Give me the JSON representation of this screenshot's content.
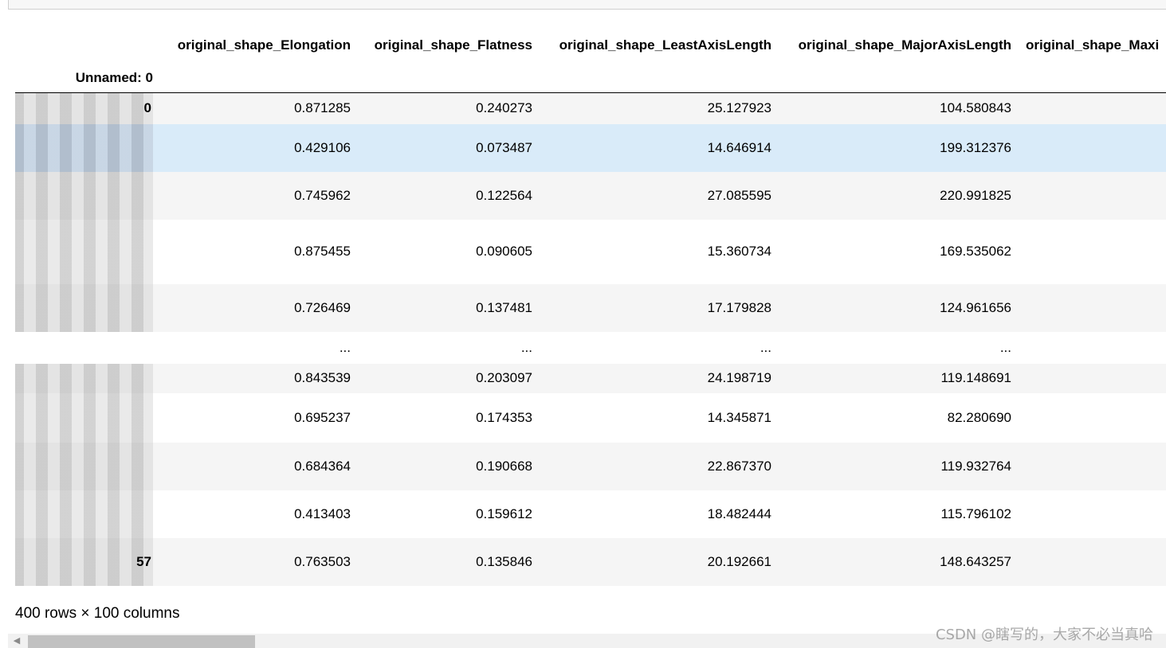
{
  "table": {
    "columns": [
      "original_shape_Elongation",
      "original_shape_Flatness",
      "original_shape_LeastAxisLength",
      "original_shape_MajorAxisLength",
      "original_shape_Maxi"
    ],
    "index_header": "Unnamed: 0",
    "rows": [
      {
        "index": "0",
        "elong": "0.871285",
        "flat": "0.240273",
        "least": "25.127923",
        "major": "104.580843"
      },
      {
        "index": "",
        "elong": "0.429106",
        "flat": "0.073487",
        "least": "14.646914",
        "major": "199.312376"
      },
      {
        "index": "",
        "elong": "0.745962",
        "flat": "0.122564",
        "least": "27.085595",
        "major": "220.991825"
      },
      {
        "index": "",
        "elong": "0.875455",
        "flat": "0.090605",
        "least": "15.360734",
        "major": "169.535062"
      },
      {
        "index": "",
        "elong": "0.726469",
        "flat": "0.137481",
        "least": "17.179828",
        "major": "124.961656"
      },
      {
        "index": "",
        "elong": "...",
        "flat": "...",
        "least": "...",
        "major": "..."
      },
      {
        "index": "",
        "elong": "0.843539",
        "flat": "0.203097",
        "least": "24.198719",
        "major": "119.148691"
      },
      {
        "index": "",
        "elong": "0.695237",
        "flat": "0.174353",
        "least": "14.345871",
        "major": "82.280690"
      },
      {
        "index": "",
        "elong": "0.684364",
        "flat": "0.190668",
        "least": "22.867370",
        "major": "119.932764"
      },
      {
        "index": "",
        "elong": "0.413403",
        "flat": "0.159612",
        "least": "18.482444",
        "major": "115.796102"
      },
      {
        "index": "57",
        "elong": "0.763503",
        "flat": "0.135846",
        "least": "20.192661",
        "major": "148.643257"
      }
    ]
  },
  "summary": "400 rows × 100 columns",
  "watermark": "CSDN @瞎写的，大家不必当真哈",
  "scrollbar": {
    "left_arrow_icon": "triangle-left-icon"
  },
  "colors": {
    "row_alt": "#f5f5f5",
    "row_hover": "#d9ebf9",
    "scroll_thumb": "#c1c1c1"
  }
}
